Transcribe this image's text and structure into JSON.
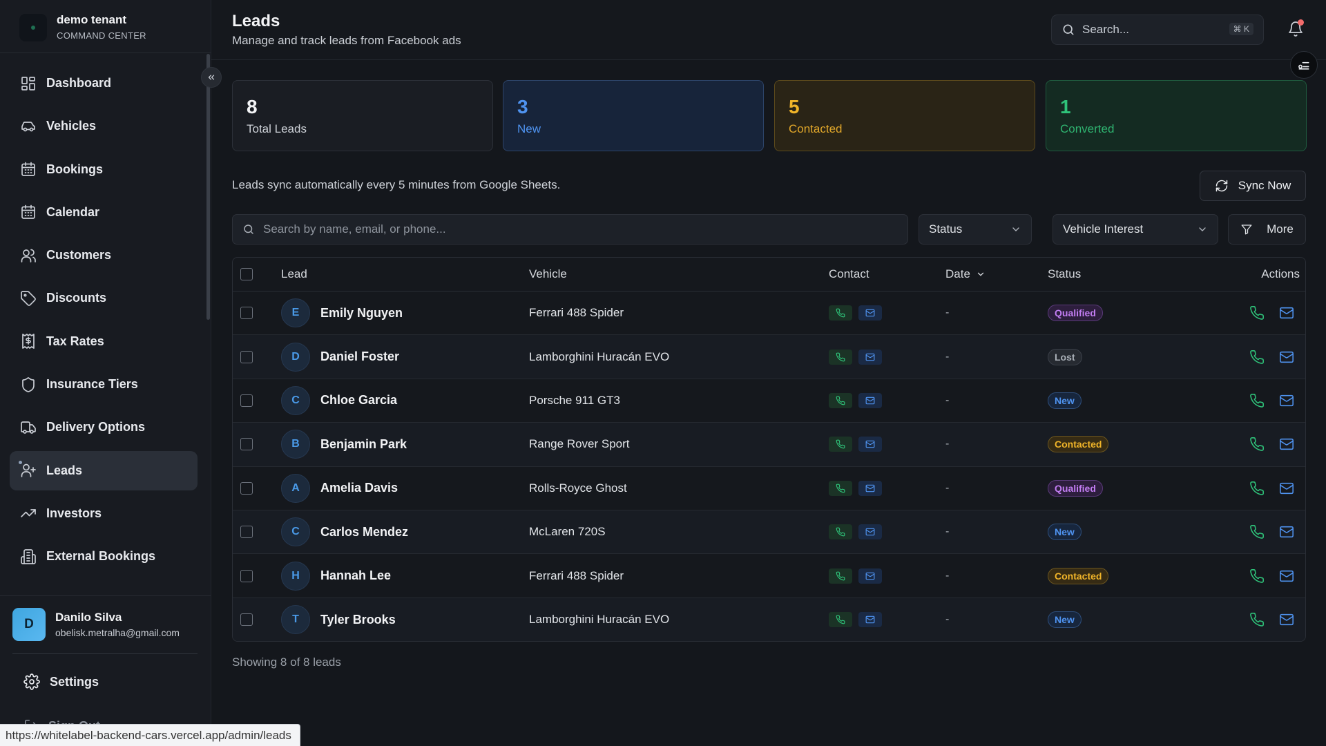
{
  "brand": {
    "name": "demo tenant",
    "subtitle": "COMMAND CENTER"
  },
  "sidebar": {
    "items": [
      {
        "label": "Dashboard",
        "icon": "dashboard-icon",
        "active": false
      },
      {
        "label": "Vehicles",
        "icon": "car-icon",
        "active": false
      },
      {
        "label": "Bookings",
        "icon": "calendar-icon",
        "active": false
      },
      {
        "label": "Calendar",
        "icon": "calendar-icon",
        "active": false
      },
      {
        "label": "Customers",
        "icon": "users-icon",
        "active": false
      },
      {
        "label": "Discounts",
        "icon": "tag-icon",
        "active": false
      },
      {
        "label": "Tax Rates",
        "icon": "receipt-icon",
        "active": false
      },
      {
        "label": "Insurance Tiers",
        "icon": "shield-icon",
        "active": false
      },
      {
        "label": "Delivery Options",
        "icon": "truck-icon",
        "active": false
      },
      {
        "label": "Leads",
        "icon": "user-plus-icon",
        "active": true
      },
      {
        "label": "Investors",
        "icon": "trending-up-icon",
        "active": false
      },
      {
        "label": "External Bookings",
        "icon": "building-icon",
        "active": false
      }
    ]
  },
  "user": {
    "initial": "D",
    "name": "Danilo Silva",
    "email": "obelisk.metralha@gmail.com"
  },
  "footer": {
    "settings_label": "Settings",
    "signout_label": "Sign Out"
  },
  "status_url": "https://whitelabel-backend-cars.vercel.app/admin/leads",
  "header": {
    "title": "Leads",
    "subtitle": "Manage and track leads from Facebook ads",
    "search_placeholder": "Search...",
    "search_shortcut": "⌘ K"
  },
  "stats": {
    "total": {
      "value": "8",
      "label": "Total Leads"
    },
    "new": {
      "value": "3",
      "label": "New"
    },
    "contacted": {
      "value": "5",
      "label": "Contacted"
    },
    "converted": {
      "value": "1",
      "label": "Converted"
    }
  },
  "sync": {
    "note": "Leads sync automatically every 5 minutes from Google Sheets.",
    "button_label": "Sync Now"
  },
  "filters": {
    "search_placeholder": "Search by name, email, or phone...",
    "status_label": "Status",
    "vehicle_label": "Vehicle Interest",
    "more_label": "More"
  },
  "table": {
    "columns": {
      "lead": "Lead",
      "vehicle": "Vehicle",
      "contact": "Contact",
      "date": "Date",
      "status": "Status",
      "actions": "Actions"
    },
    "rows": [
      {
        "initial": "E",
        "name": "Emily Nguyen",
        "vehicle": "Ferrari 488 Spider",
        "date": "-",
        "status": "Qualified",
        "status_key": "qualified"
      },
      {
        "initial": "D",
        "name": "Daniel Foster",
        "vehicle": "Lamborghini Huracán EVO",
        "date": "-",
        "status": "Lost",
        "status_key": "lost"
      },
      {
        "initial": "C",
        "name": "Chloe Garcia",
        "vehicle": "Porsche 911 GT3",
        "date": "-",
        "status": "New",
        "status_key": "new"
      },
      {
        "initial": "B",
        "name": "Benjamin Park",
        "vehicle": "Range Rover Sport",
        "date": "-",
        "status": "Contacted",
        "status_key": "contacted"
      },
      {
        "initial": "A",
        "name": "Amelia Davis",
        "vehicle": "Rolls-Royce Ghost",
        "date": "-",
        "status": "Qualified",
        "status_key": "qualified"
      },
      {
        "initial": "C",
        "name": "Carlos Mendez",
        "vehicle": "McLaren 720S",
        "date": "-",
        "status": "New",
        "status_key": "new"
      },
      {
        "initial": "H",
        "name": "Hannah Lee",
        "vehicle": "Ferrari 488 Spider",
        "date": "-",
        "status": "Contacted",
        "status_key": "contacted"
      },
      {
        "initial": "T",
        "name": "Tyler Brooks",
        "vehicle": "Lamborghini Huracán EVO",
        "date": "-",
        "status": "New",
        "status_key": "new"
      }
    ]
  },
  "showing": "Showing 8 of 8 leads",
  "colors": {
    "accent_blue": "#4f93f0",
    "accent_green": "#2fc37a",
    "accent_amber": "#f0b429",
    "accent_purple": "#c27df2",
    "background": "#14171c"
  }
}
